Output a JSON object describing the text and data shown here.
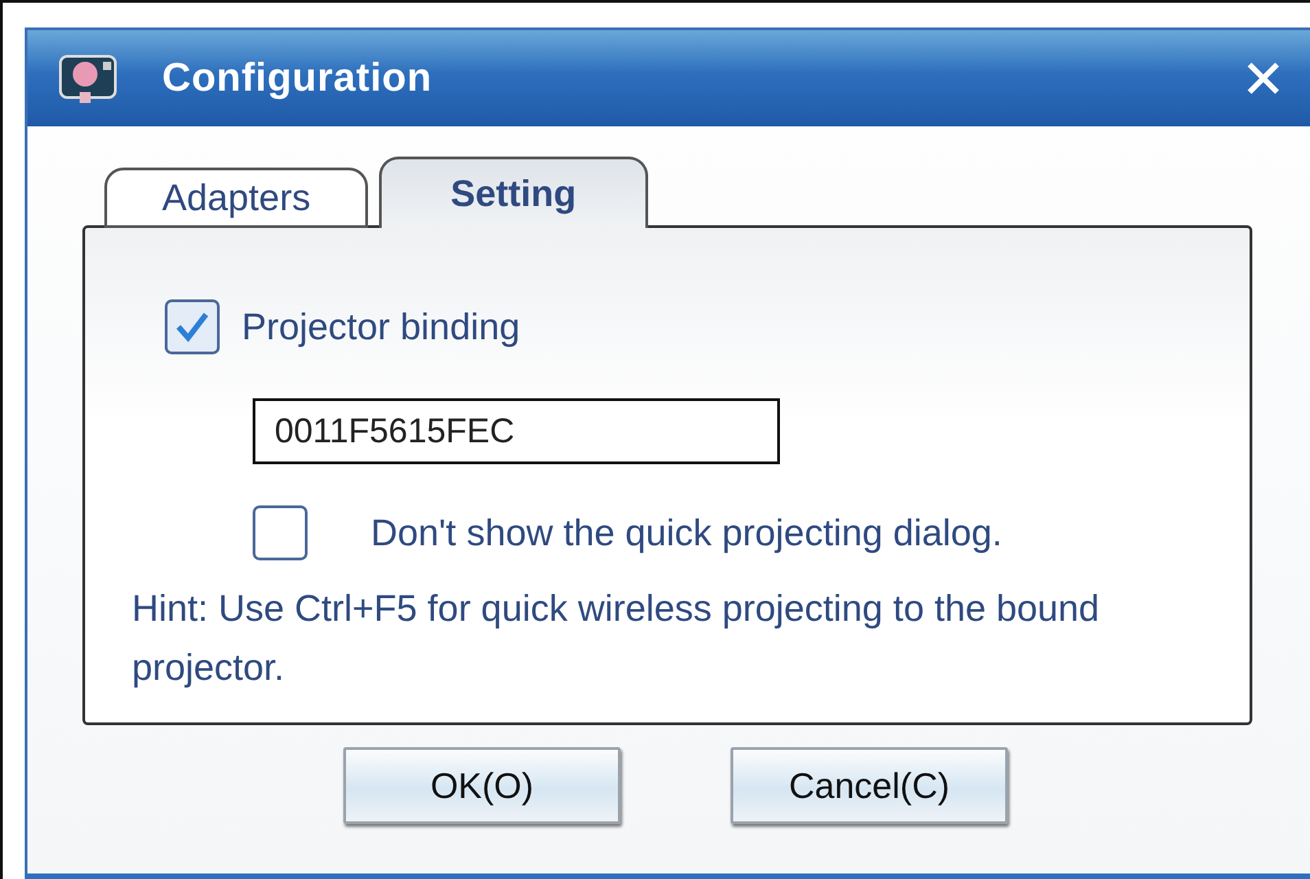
{
  "window": {
    "title": "Configuration"
  },
  "tabs": [
    {
      "label": "Adapters",
      "selected": false
    },
    {
      "label": "Setting",
      "selected": true
    }
  ],
  "binding": {
    "label": "Projector binding",
    "checked": true,
    "value": "0011F5615FEC"
  },
  "quick_dialog": {
    "label": "Don't show the quick projecting dialog.",
    "checked": false
  },
  "hint": "Hint: Use Ctrl+F5 for quick wireless projecting  to the bound projector.",
  "buttons": [
    "OK(O)",
    "Cancel(C)"
  ]
}
